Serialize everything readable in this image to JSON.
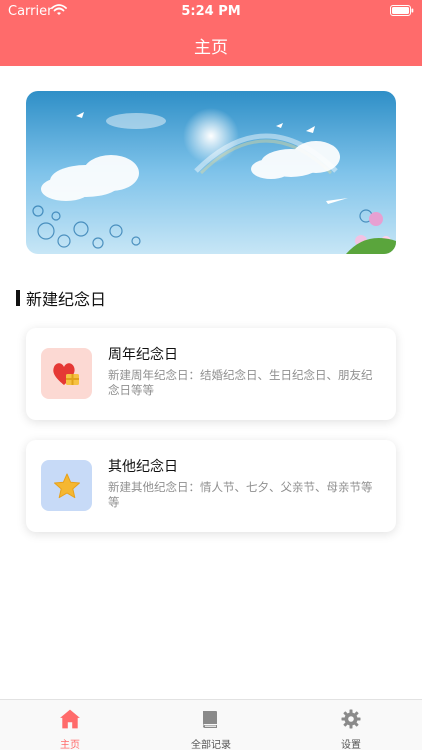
{
  "status_bar": {
    "carrier": "Carrier",
    "time": "5:24 PM"
  },
  "nav": {
    "title": "主页"
  },
  "banner": {
    "icon": "sky-clouds-rainbow-image"
  },
  "section": {
    "title": "新建纪念日"
  },
  "cards": [
    {
      "title": "周年纪念日",
      "description": "新建周年纪念日：结婚纪念日、生日纪念日、朋友纪念日等等",
      "icon": "heart-gift-icon"
    },
    {
      "title": "其他纪念日",
      "description": "新建其他纪念日：情人节、七夕、父亲节、母亲节等等",
      "icon": "star-icon"
    }
  ],
  "tabs": [
    {
      "label": "主页",
      "icon": "home-icon",
      "active": true
    },
    {
      "label": "全部记录",
      "icon": "book-icon",
      "active": false
    },
    {
      "label": "设置",
      "icon": "gear-icon",
      "active": false
    }
  ],
  "colors": {
    "accent": "#ff6b6b",
    "inactive": "#8a8a8a"
  }
}
